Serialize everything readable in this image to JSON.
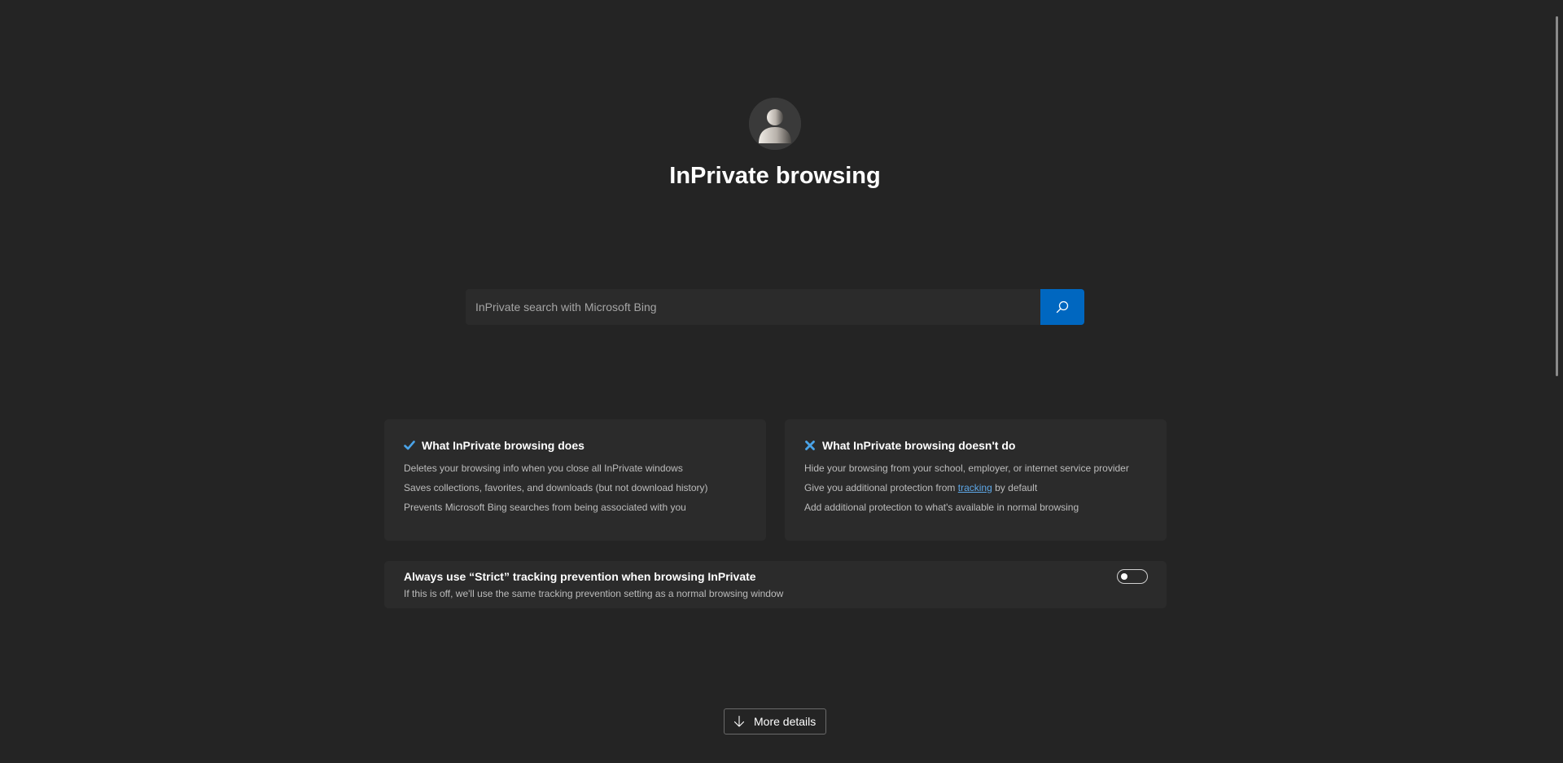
{
  "header": {
    "title": "InPrivate browsing"
  },
  "search": {
    "placeholder": "InPrivate search with Microsoft Bing",
    "value": ""
  },
  "does_card": {
    "heading": "What InPrivate browsing does",
    "icon": "checkmark-icon",
    "items": [
      "Deletes your browsing info when you close all InPrivate windows",
      "Saves collections, favorites, and downloads (but not download history)",
      "Prevents Microsoft Bing searches from being associated with you"
    ]
  },
  "doesnt_card": {
    "heading": "What InPrivate browsing doesn't do",
    "icon": "cross-icon",
    "items": [
      "Hide your browsing from your school, employer, or internet service provider",
      "Add additional protection to what's available in normal browsing"
    ],
    "protection_item": {
      "prefix": "Give you additional protection from ",
      "link": "tracking",
      "suffix": " by default"
    }
  },
  "strict": {
    "title": "Always use “Strict” tracking prevention when browsing InPrivate",
    "description": "If this is off, we'll use the same tracking prevention setting as a normal browsing window",
    "enabled": false
  },
  "more_details": {
    "label": "More details"
  },
  "colors": {
    "background": "#242424",
    "card": "#2b2b2b",
    "accent": "#0067c0",
    "link": "#5ea8e8",
    "icon_blue": "#4aa3e8"
  }
}
